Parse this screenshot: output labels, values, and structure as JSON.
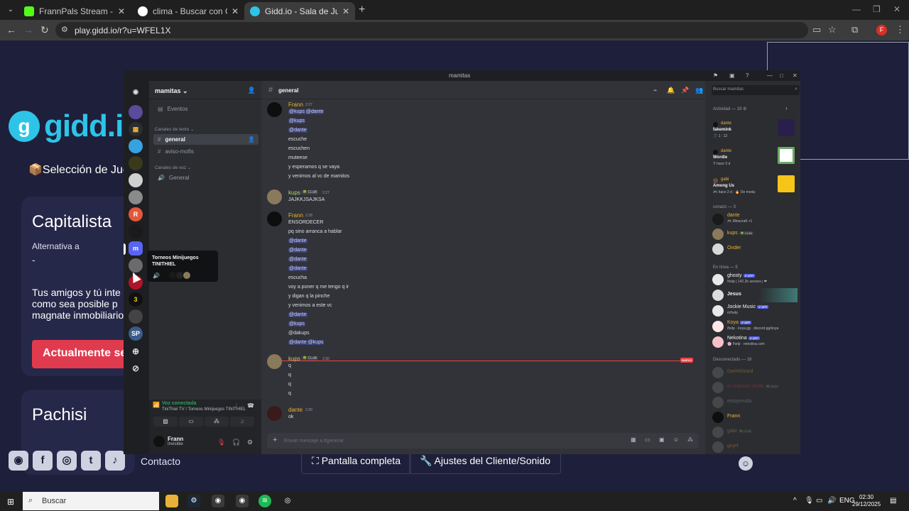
{
  "browser": {
    "tabs": [
      {
        "title": "FrannPals Stream - Watch Live o",
        "favicon_color": "#53fc18"
      },
      {
        "title": "clima - Buscar con Google",
        "favicon_color": "#ffffff"
      },
      {
        "title": "Gidd.io - Sala de Juegos de Fra",
        "favicon_color": "#2ec4e8"
      }
    ],
    "url": "play.gidd.io/r?u=WFEL1X",
    "profile_initial": "F"
  },
  "gidd": {
    "logo_text": "gidd.io",
    "logo_letter": "g",
    "selection_title": "📦Selección de Jueg",
    "card1": {
      "title": "Capitalista",
      "alt_label": "Alternativa a",
      "alt_value": "-",
      "description": "Tus amigos y tú inte\ncomo sea posible p\nmagnate inmobiliario.",
      "button": "Actualmente sele"
    },
    "card2": {
      "title": "Pachisi"
    },
    "footer": {
      "contact": "Contacto",
      "fullscreen": "⛶ Pantalla completa",
      "settings": "🔧 Ajustes del Cliente/Sonido"
    }
  },
  "discord": {
    "window_title": "mamitas",
    "server_name": "mamitas ⌄",
    "channels": {
      "events": "Eventos",
      "text_category": "Canales de texto ⌄",
      "text": [
        "general",
        "aviso-mofis"
      ],
      "voice_category": "Canales de voz ⌄",
      "voice": [
        "General"
      ]
    },
    "voice_panel": {
      "status": "Voz conectada",
      "location": "TiniThiel TV / Torneos Minijuegos TINITHIEL"
    },
    "user": {
      "name": "Frann",
      "status": "Invisible"
    },
    "tooltip": {
      "title": "Torneos Minijuegos\nTINITHIEL"
    },
    "chat": {
      "channel": "general",
      "composer_placeholder": "Enviar mensaje a #general",
      "new_badge": "NUEVO",
      "messages": [
        {
          "author": "Frann",
          "time": "2:27",
          "club": "",
          "lines": [
            "@kups @dante",
            "@kups",
            "@dante",
            "escuche",
            "escuchen",
            "muteese",
            "y esperamos q se vaya",
            "y venimos al vc de mamitos"
          ]
        },
        {
          "author": "kups",
          "time": "2:27",
          "club": "🍀 CLüB",
          "lines": [
            "JAJKKJSAJKSA"
          ]
        },
        {
          "author": "Frann",
          "time": "2:28",
          "club": "",
          "lines": [
            "ENSORDECER",
            "pq sino arranca a hablar",
            "@dante",
            "@dante",
            "@dante",
            "@dante",
            "escucha",
            "voy a poner q me tengo q ir",
            "y digan q la pinche",
            "y venimos a este vc",
            "@dante",
            "@kups",
            "@dakups",
            "@dante @kups"
          ]
        },
        {
          "author": "kups",
          "time": "2:30",
          "club": "🍀 CLüB",
          "lines": [
            "q",
            "q",
            "q",
            "q"
          ]
        },
        {
          "author": "dante",
          "time": "2:30",
          "club": "",
          "lines": [
            "ok"
          ]
        }
      ]
    },
    "members": {
      "search_placeholder": "Buscar mamitas",
      "activity_header": "Actividad — 19 ⚙",
      "activities": [
        {
          "user": "dante",
          "game": "fakemink",
          "meta": "🎵 1 : 12"
        },
        {
          "user": "dante",
          "game": "Wordle",
          "meta": "⠿ hace 3 d"
        },
        {
          "user": "gabi",
          "game": "Among Us",
          "meta": "🎮 hace 2 d · 🔥 De moda"
        }
      ],
      "groups": [
        {
          "header": "conazo — 3",
          "items": [
            {
              "name": "dante",
              "sub": "🎮 Minecraft +1",
              "tag": "",
              "color": "#f0b232"
            },
            {
              "name": "kups",
              "sub": "",
              "tag": "🍀 CLüB",
              "color": "#f0b232"
            },
            {
              "name": "Onder",
              "sub": "",
              "tag": "",
              "color": "#f0b232"
            }
          ]
        },
        {
          "header": "En línea — 5",
          "items": [
            {
              "name": "ghosty",
              "sub": "!help | 142.2k servers | ❤",
              "tag": "✔ APP",
              "color": "#f2f3f5"
            },
            {
              "name": "Jesus",
              "sub": "",
              "tag": "",
              "color": "#f2f3f5"
            },
            {
              "name": "Jockie Music",
              "sub": "m!help",
              "tag": "✔ APP",
              "color": "#f2f3f5"
            },
            {
              "name": "Koya",
              "sub": "/help · koya.gg · discord.gg/koya",
              "tag": "✔ APP",
              "color": "#f0b232"
            },
            {
              "name": "Nekotina",
              "sub": "🌸 !help · nekotina.com",
              "tag": "✔ APP",
              "color": "#f2f3f5"
            }
          ]
        },
        {
          "header": "Desconectado — 18",
          "items": [
            {
              "name": "DarkWizard",
              "sub": "",
              "tag": "",
              "color": "#f0b232"
            },
            {
              "name": "el chavote verde",
              "sub": "",
              "tag": "🍀 KING",
              "color": "#f23f43"
            },
            {
              "name": "estoymuda",
              "sub": "",
              "tag": "",
              "color": "#b5bac1"
            },
            {
              "name": "Frann",
              "sub": "",
              "tag": "",
              "color": "#f0b232"
            },
            {
              "name": "gabi",
              "sub": "",
              "tag": "🍀 CLüB",
              "color": "#f0b232"
            },
            {
              "name": "guyrt",
              "sub": "",
              "tag": "",
              "color": "#f0b232"
            }
          ]
        }
      ]
    }
  },
  "taskbar": {
    "search": "Buscar",
    "lang": "ENG",
    "time": "02:30",
    "date": "29/12/2025"
  }
}
